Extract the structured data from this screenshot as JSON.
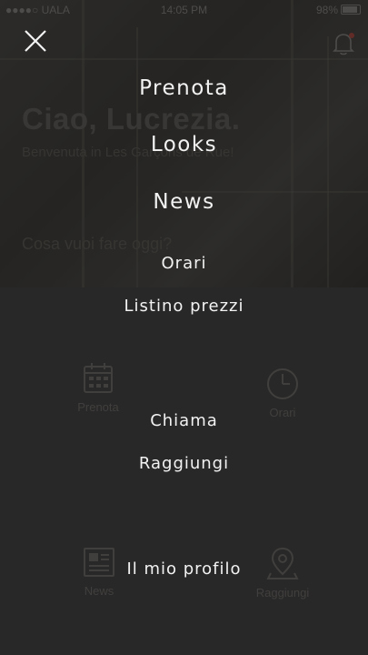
{
  "status_bar": {
    "carrier": "●●●●○ UALA",
    "time": "14:05 PM",
    "battery": "98%"
  },
  "hero": {
    "greeting": "Ciao, Lucrezia.",
    "subtitle": "Benvenuta in Les Garçons de Rue!",
    "question": "Cosa vuoi fare oggi?"
  },
  "tiles": [
    {
      "label": "Prenota",
      "icon": "calendar-icon"
    },
    {
      "label": "Orari",
      "icon": "clock-icon"
    },
    {
      "label": "News",
      "icon": "newspaper-icon"
    },
    {
      "label": "Raggiungi",
      "icon": "map-pin-icon"
    }
  ],
  "menu": [
    {
      "label": "Prenota"
    },
    {
      "label": "Looks"
    },
    {
      "label": "News"
    },
    {
      "label": "Orari"
    },
    {
      "label": "Listino prezzi"
    },
    {
      "label": "Chiama"
    },
    {
      "label": "Raggiungi"
    },
    {
      "label": "Il mio profilo"
    }
  ],
  "icons": {
    "close": "close-icon",
    "notifications": "bell-icon"
  },
  "colors": {
    "background": "#2c2c2c",
    "menu_text": "#f2f2f2",
    "notification_dot": "#c0392b"
  }
}
